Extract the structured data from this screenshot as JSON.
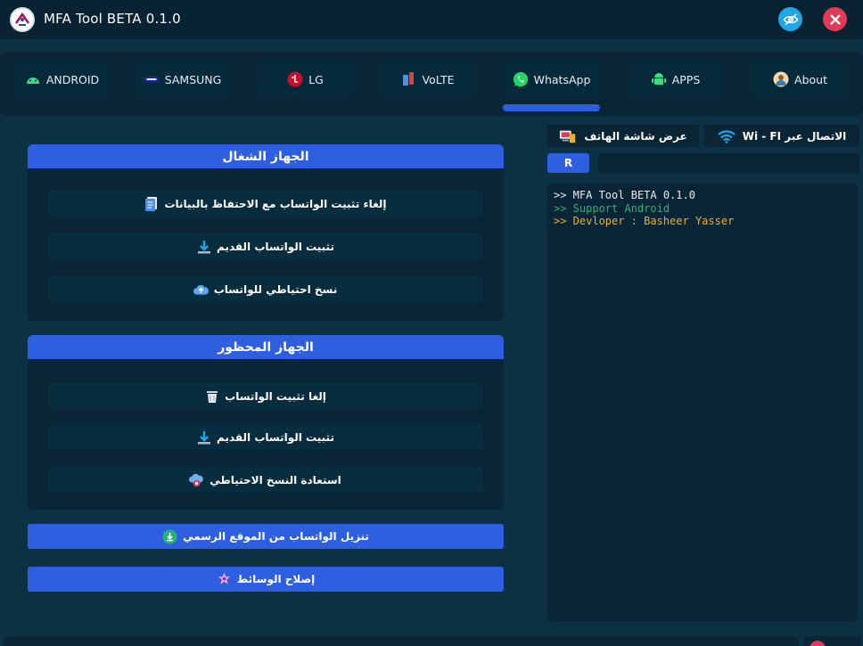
{
  "window": {
    "title": "MFA Tool BETA 0.1.0"
  },
  "colors": {
    "accent": "#2d5fe0",
    "close": "#e23955",
    "hide": "#1ea6e6",
    "success": "#22b573",
    "warning": "#f0b020"
  },
  "tabs": [
    {
      "label": "ANDROID",
      "icon": "android-icon"
    },
    {
      "label": "SAMSUNG",
      "icon": "samsung-icon"
    },
    {
      "label": "LG",
      "icon": "lg-icon"
    },
    {
      "label": "VoLTE",
      "icon": "volte-icon"
    },
    {
      "label": "WhatsApp",
      "icon": "whatsapp-icon",
      "active": true
    },
    {
      "label": "APPS",
      "icon": "apps-icon"
    },
    {
      "label": "About",
      "icon": "about-icon"
    }
  ],
  "running_device": {
    "title": "الجهاز الشغال",
    "actions": [
      {
        "label": "إلغاء تثبيت الواتساب مع الاحتفاظ بالبيانات",
        "icon": "document-icon"
      },
      {
        "label": "تثبيت الواتساب القديم",
        "icon": "download-icon"
      },
      {
        "label": "نسخ احتياطي للواتساب",
        "icon": "cloud-upload-icon"
      }
    ]
  },
  "blocked_device": {
    "title": "الجهاز المحظور",
    "actions": [
      {
        "label": "إلغا تثبيت الواتساب",
        "icon": "trash-icon"
      },
      {
        "label": "تثبيت الواتساب القديم",
        "icon": "download-icon"
      },
      {
        "label": "استعادة النسخ الاحتياطي",
        "icon": "cloud-restore-icon"
      }
    ]
  },
  "bottom_actions": [
    {
      "label": "تنزيل الواتساب من الموقع الرسمي",
      "icon": "download-circle-icon"
    },
    {
      "label": "إصلاح الوسائط",
      "icon": "media-fix-icon"
    }
  ],
  "right_panel": {
    "screen_button": "عرض شاشة الهاتف",
    "wifi_button": "الاتصال عبر Wi - FI",
    "r_button": "R",
    "input_value": "",
    "console_lines": [
      ">> MFA Tool BETA 0.1.0",
      ">> Support Android",
      ">> Devloper : Basheer Yasser"
    ]
  }
}
